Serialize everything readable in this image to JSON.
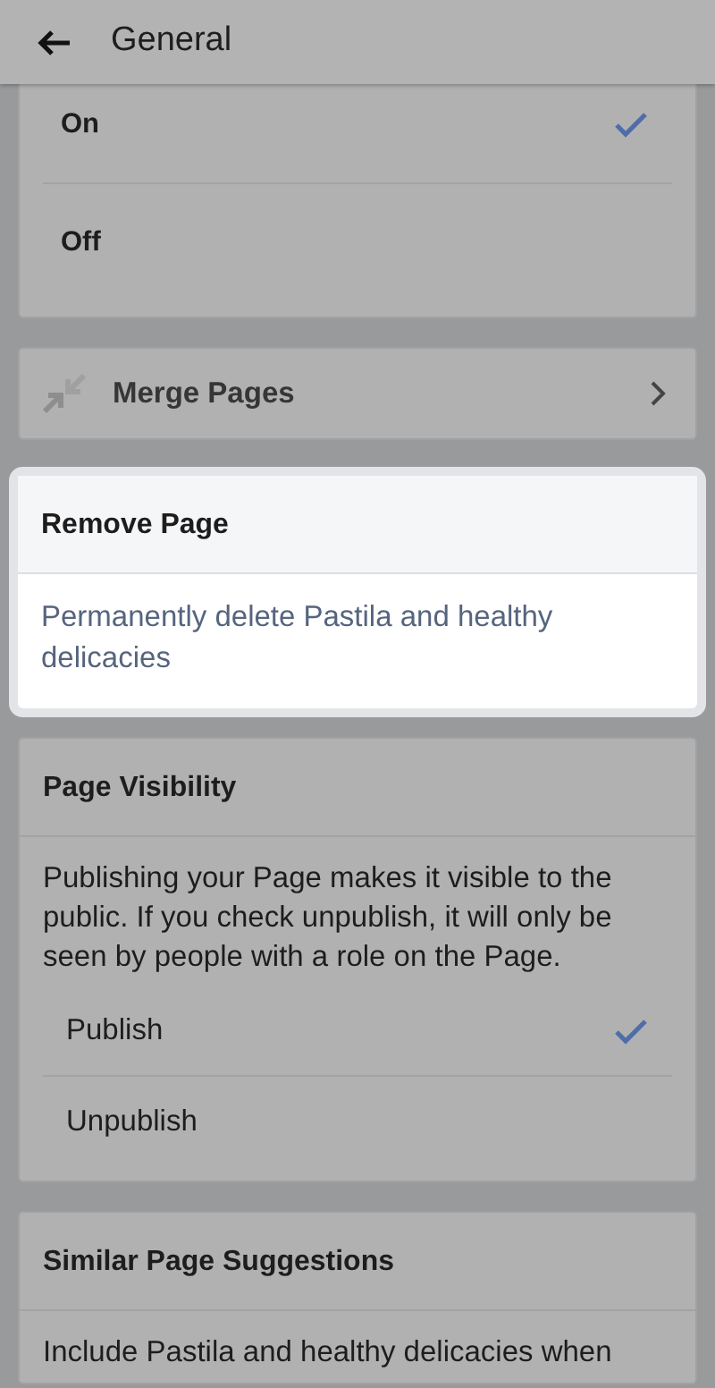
{
  "header": {
    "title": "General"
  },
  "sections": [
    {
      "kind": "options",
      "highlighted": false,
      "options": [
        {
          "label": "On",
          "selected": true
        },
        {
          "label": "Off",
          "selected": false
        }
      ]
    },
    {
      "kind": "link",
      "highlighted": false,
      "label": "Merge Pages"
    },
    {
      "kind": "action",
      "highlighted": true,
      "title": "Remove Page",
      "link": "Permanently delete Pastila and healthy delicacies"
    },
    {
      "kind": "options",
      "highlighted": false,
      "title": "Page Visibility",
      "description": "Publishing your Page makes it visible to the public. If you check unpublish, it will only be seen by people with a role on the Page.",
      "options": [
        {
          "label": "Publish",
          "selected": true
        },
        {
          "label": "Unpublish",
          "selected": false
        }
      ]
    },
    {
      "kind": "text",
      "highlighted": false,
      "title": "Similar Page Suggestions",
      "description": "Include Pastila and healthy delicacies when"
    }
  ]
}
